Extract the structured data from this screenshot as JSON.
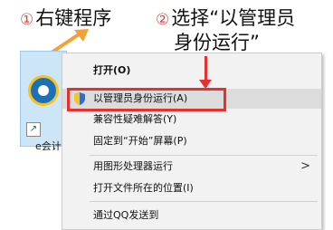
{
  "annotations": {
    "step1_num": "①",
    "step1_text": "右键程序",
    "step2_num": "②",
    "step2_text_line1": "选择“以管理员",
    "step2_text_line2": "身份运行”"
  },
  "desktop_icon": {
    "label": "e会计",
    "icon": "e-accounting-app-icon"
  },
  "context_menu": {
    "items": [
      {
        "label": "打开(O)",
        "bold": true
      },
      {
        "label": "以管理员身份运行(A)",
        "icon": "uac-shield-icon",
        "highlighted": true
      },
      {
        "label": "兼容性疑难解答(Y)"
      },
      {
        "label": "固定到“开始”屏幕(P)"
      },
      {
        "label": "用图形处理器运行",
        "submenu": true
      },
      {
        "label": "打开文件所在的位置(I)"
      },
      {
        "label": "通过QQ发送到"
      }
    ]
  },
  "colors": {
    "highlight_border": "#e8312e",
    "pointer_arrow": "#f5a033",
    "menu_background": "#f2f2f2"
  }
}
